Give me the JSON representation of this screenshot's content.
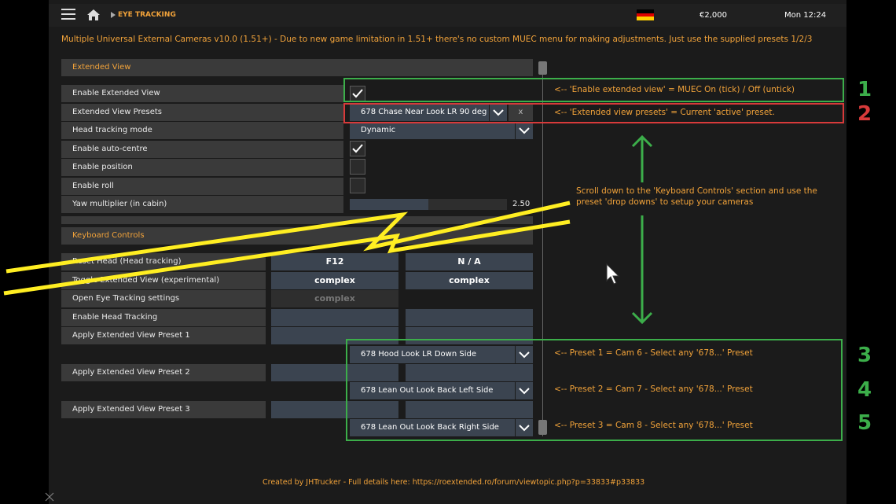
{
  "topbar": {
    "title": "EYE TRACKING",
    "money": "€2,000",
    "time": "Mon 12:24"
  },
  "banner": "Multiple Universal External Cameras v10.0 (1.51+) - Due to new game limitation in 1.51+ there's no custom MUEC menu for making adjustments. Just use the supplied presets 1/2/3",
  "extended_view": {
    "section": "Extended View",
    "rows": {
      "enable_ev": "Enable Extended View",
      "ev_presets": "Extended View Presets",
      "head_mode": "Head tracking mode",
      "auto_centre": "Enable auto-centre",
      "position": "Enable position",
      "roll": "Enable roll",
      "yaw": "Yaw multiplier (in cabin)"
    },
    "preset_value": "678 Chase Near Look LR 90 deg",
    "preset_clear": "x",
    "head_mode_value": "Dynamic",
    "yaw_value": "2.50",
    "yaw_level": 0.5
  },
  "keyboard": {
    "section": "Keyboard Controls",
    "rows": {
      "reset_head": "Reset Head (Head tracking)",
      "toggle_ev": "Toggle Extended View (experimental)",
      "open_eye": "Open Eye Tracking settings",
      "enable_head": "Enable Head Tracking",
      "preset1": "Apply Extended View Preset 1",
      "preset2": "Apply Extended View Preset 2",
      "preset3": "Apply Extended View Preset 3"
    },
    "keys": {
      "reset_primary": "F12",
      "reset_secondary": "N / A",
      "toggle_primary": "complex",
      "toggle_secondary": "complex",
      "open_primary": "complex"
    },
    "preset_dropdowns": {
      "p1": "678 Hood Look LR Down Side",
      "p2": "678 Lean Out Look Back Left Side",
      "p3": "678 Lean Out Look Back Right Side"
    }
  },
  "annotations": {
    "note1": "<-- 'Enable extended view' = MUEC On (tick) / Off (untick)",
    "note2": "<-- 'Extended view presets' = Current 'active' preset.",
    "scroll_note_1": "Scroll down to the 'Keyboard Controls' section and use the",
    "scroll_note_2": "preset 'drop downs' to setup your cameras",
    "note3": "<-- Preset 1 = Cam 6 - Select any '678...' Preset",
    "note4": "<-- Preset 2 = Cam 7 - Select any '678...' Preset",
    "note5": "<-- Preset 3 = Cam 8 - Select any '678...' Preset",
    "n1": "1",
    "n2": "2",
    "n3": "3",
    "n4": "4",
    "n5": "5"
  },
  "footer": "Created by JHTrucker - Full details here: https://roextended.ro/forum/viewtopic.php?p=33833#p33833",
  "colors": {
    "accent": "#f2a33a",
    "green": "#3cae4a",
    "red": "#d73a3a",
    "yellow": "#ffee22"
  }
}
